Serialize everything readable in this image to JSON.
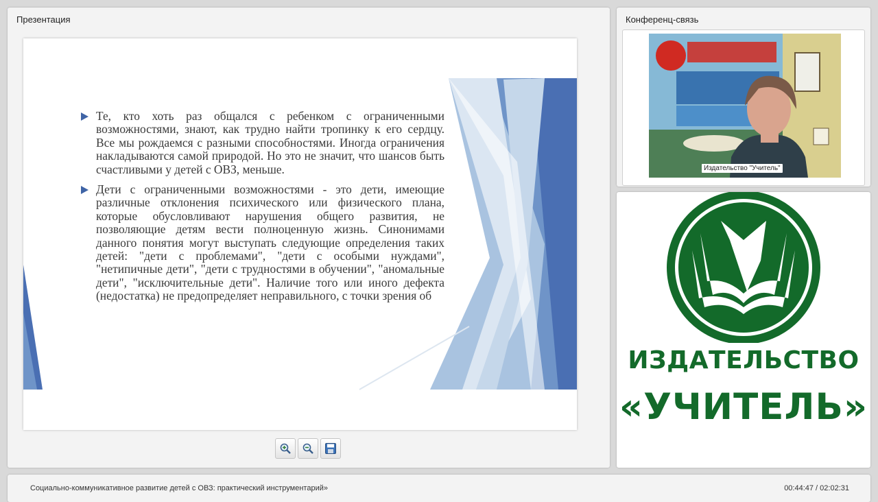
{
  "presentation": {
    "title": "Презентация",
    "slide": {
      "bullets": [
        "Те, кто хоть раз общался с ребенком с ограниченными возможностями, знают, как трудно найти тропинку к его сердцу. Все мы рождаемся с разными способностями. Иногда ограничения накладываются самой природой. Но это не значит, что шансов быть счастливыми у детей с ОВЗ, меньше.",
        "Дети с ограниченными возможностями - это дети, имеющие различные отклонения психического или физического плана, которые обусловливают нарушения общего развития, не позволяющие детям вести полноценную жизнь. Синонимами данного понятия могут выступать следующие определения таких детей: \"дети с проблемами\", \"дети с особыми нуждами\", \"нетипичные дети\", \"дети с трудностями в обучении\", \"аномальные дети\", \"исключительные дети\". Наличие того или иного дефекта (недостатка) не предопределяет неправильного, с точки зрения об"
      ],
      "accent_color": "#3f64a6"
    },
    "toolbar": {
      "zoom_in_icon": "zoom-in-icon",
      "zoom_out_icon": "zoom-out-icon",
      "save_icon": "save-icon"
    }
  },
  "conference": {
    "title": "Конференц-связь",
    "video_label": "Издательство \"Учитель\""
  },
  "logo": {
    "line1": "ИЗДАТЕЛЬСТВО",
    "line2": "«УЧИТЕЛЬ»",
    "color": "#136a2a"
  },
  "bottom": {
    "course_title": "Социально-коммуникативное развитие детей с ОВЗ: практический инструментарий»",
    "timer": "00:44:47 / 02:02:31"
  }
}
